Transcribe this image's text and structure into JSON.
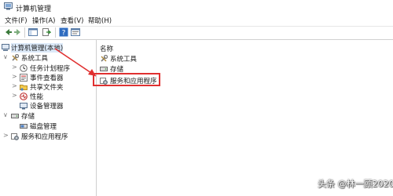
{
  "window": {
    "title": "计算机管理"
  },
  "menu": [
    {
      "label": "文件(F)"
    },
    {
      "label": "操作(A)"
    },
    {
      "label": "查看(V)"
    },
    {
      "label": "帮助(H)"
    }
  ],
  "tree": {
    "root": "计算机管理(本地)",
    "system_tools": "系统工具",
    "task_scheduler": "任务计划程序",
    "event_viewer": "事件查看器",
    "shared_folders": "共享文件夹",
    "performance": "性能",
    "device_manager": "设备管理器",
    "storage": "存储",
    "disk_management": "磁盘管理",
    "services_apps": "服务和应用程序"
  },
  "list": {
    "column_name": "名称",
    "items": [
      {
        "label": "系统工具"
      },
      {
        "label": "存储"
      },
      {
        "label": "服务和应用程序"
      }
    ]
  },
  "annotation": {
    "color": "#e03030"
  },
  "watermark": {
    "text": "头条 @林一顾2020"
  }
}
